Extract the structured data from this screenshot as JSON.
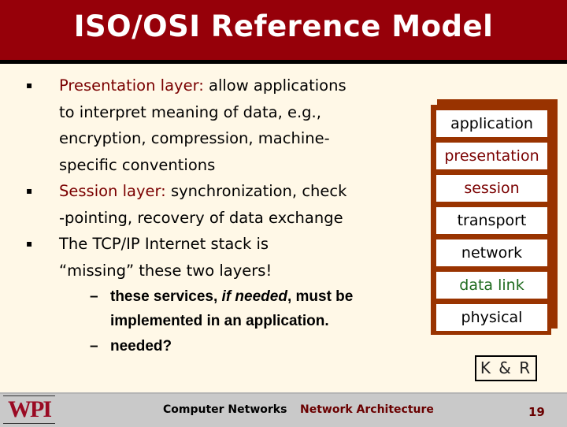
{
  "slide": {
    "title": "ISO/OSI Reference Model",
    "bullets": [
      {
        "highlight": "Presentation layer:",
        "lines": [
          " allow applications",
          "to interpret meaning of data, e.g.,",
          "encryption, compression, machine-",
          "specific conventions"
        ]
      },
      {
        "highlight": "Session layer:",
        "lines": [
          " synchronization, check",
          "-pointing, recovery of data exchange"
        ]
      },
      {
        "highlight": "",
        "lines": [
          "The TCP/IP Internet stack is",
          "“missing” these two layers!"
        ]
      }
    ],
    "sub_bullets": [
      {
        "pre": "these services, ",
        "em": "if needed",
        "post": ", must be",
        "line2": "implemented in an application."
      },
      {
        "pre": "needed?",
        "em": "",
        "post": "",
        "line2": ""
      }
    ],
    "bullet_glyph": "▪",
    "dash_glyph": "–"
  },
  "stack": {
    "layers": [
      {
        "label": "application",
        "color": "#000000"
      },
      {
        "label": "presentation",
        "color": "#7a0000"
      },
      {
        "label": "session",
        "color": "#7a0000"
      },
      {
        "label": "transport",
        "color": "#000000"
      },
      {
        "label": "network",
        "color": "#000000"
      },
      {
        "label": "data link",
        "color": "#1f6b1f"
      },
      {
        "label": "physical",
        "color": "#000000"
      }
    ],
    "frame_color": "#993300"
  },
  "citation": "K & R",
  "footer": {
    "logo": "WPI",
    "course": "Computer Networks",
    "topic": "Network Architecture",
    "page": "19"
  }
}
